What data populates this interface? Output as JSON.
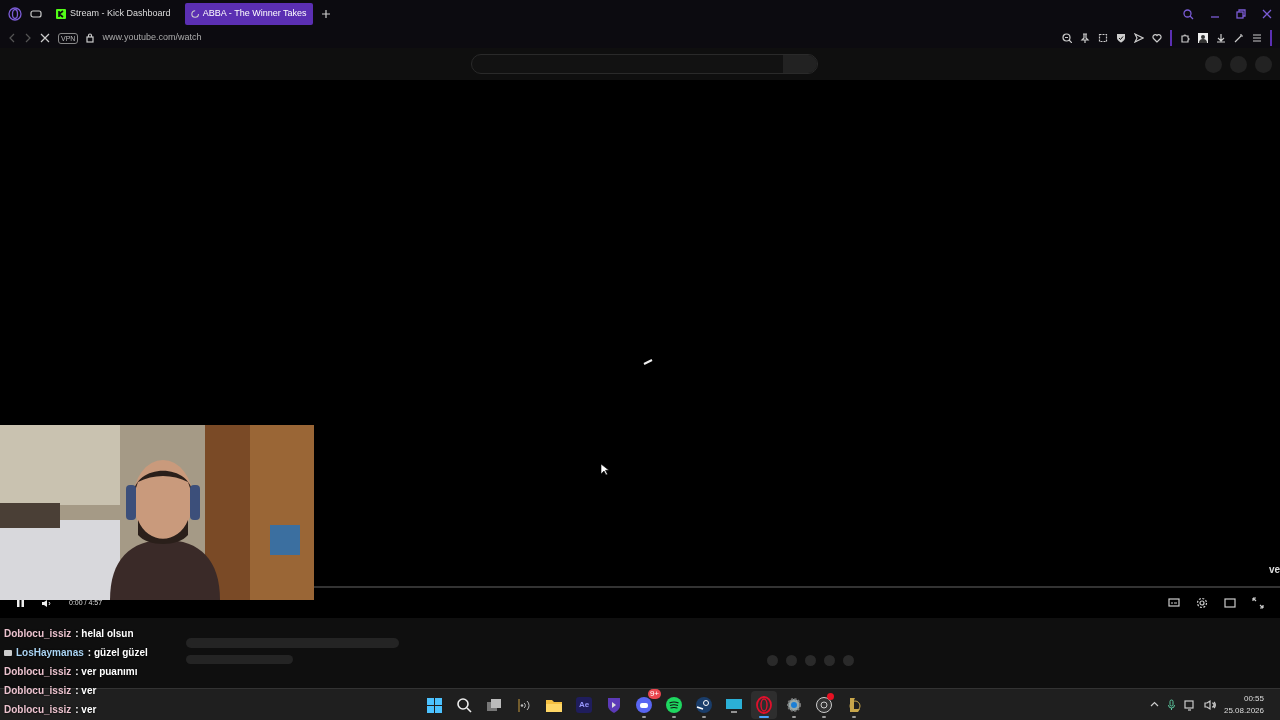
{
  "browser": {
    "tabs": [
      {
        "label": "Stream - Kick Dashboard",
        "selected": false,
        "loading": false
      },
      {
        "label": "ABBA - The Winner Takes",
        "selected": true,
        "loading": true
      }
    ],
    "address": {
      "vpn": "VPN",
      "url": "www.youtube.com/watch",
      "loading": true
    }
  },
  "player": {
    "playing": true,
    "time": "0:00 / 4:57",
    "edge_text": "ve"
  },
  "chat": [
    {
      "user": "Doblocu_issiz",
      "text": ": helal olsun",
      "color": "#ecc3cf",
      "badge": false
    },
    {
      "user": "LosHaymanas",
      "text": ": güzel güzel",
      "color": "#a9d3f2",
      "badge": true
    },
    {
      "user": "Doblocu_issiz",
      "text": ": ver puanımı",
      "color": "#ecc3cf",
      "badge": false
    },
    {
      "user": "Doblocu_issiz",
      "text": ": ver",
      "color": "#ecc3cf",
      "badge": false
    },
    {
      "user": "Doblocu_issiz",
      "text": ": ver",
      "color": "#ecc3cf",
      "badge": false
    }
  ],
  "taskbar": {
    "apps": [
      {
        "kind": "start",
        "running": false,
        "selected": false
      },
      {
        "kind": "search",
        "running": false,
        "selected": false
      },
      {
        "kind": "taskview",
        "running": false,
        "selected": false
      },
      {
        "kind": "audio",
        "running": false,
        "selected": false
      },
      {
        "kind": "folder",
        "running": false,
        "selected": false
      },
      {
        "kind": "ae",
        "label": "Ae",
        "running": false,
        "selected": false
      },
      {
        "kind": "shield",
        "running": false,
        "selected": false
      },
      {
        "kind": "discord",
        "badge": "9+",
        "running": true,
        "selected": false
      },
      {
        "kind": "spotify",
        "running": true,
        "selected": false
      },
      {
        "kind": "steam",
        "running": true,
        "selected": false
      },
      {
        "kind": "monitor",
        "running": false,
        "selected": false
      },
      {
        "kind": "opera",
        "running": true,
        "selected": true
      },
      {
        "kind": "gear",
        "running": true,
        "selected": false
      },
      {
        "kind": "obs",
        "alert": true,
        "running": true,
        "selected": false
      },
      {
        "kind": "league",
        "running": true,
        "selected": false
      }
    ],
    "clock": {
      "time": "00:55",
      "date": "25.08.2026"
    }
  }
}
